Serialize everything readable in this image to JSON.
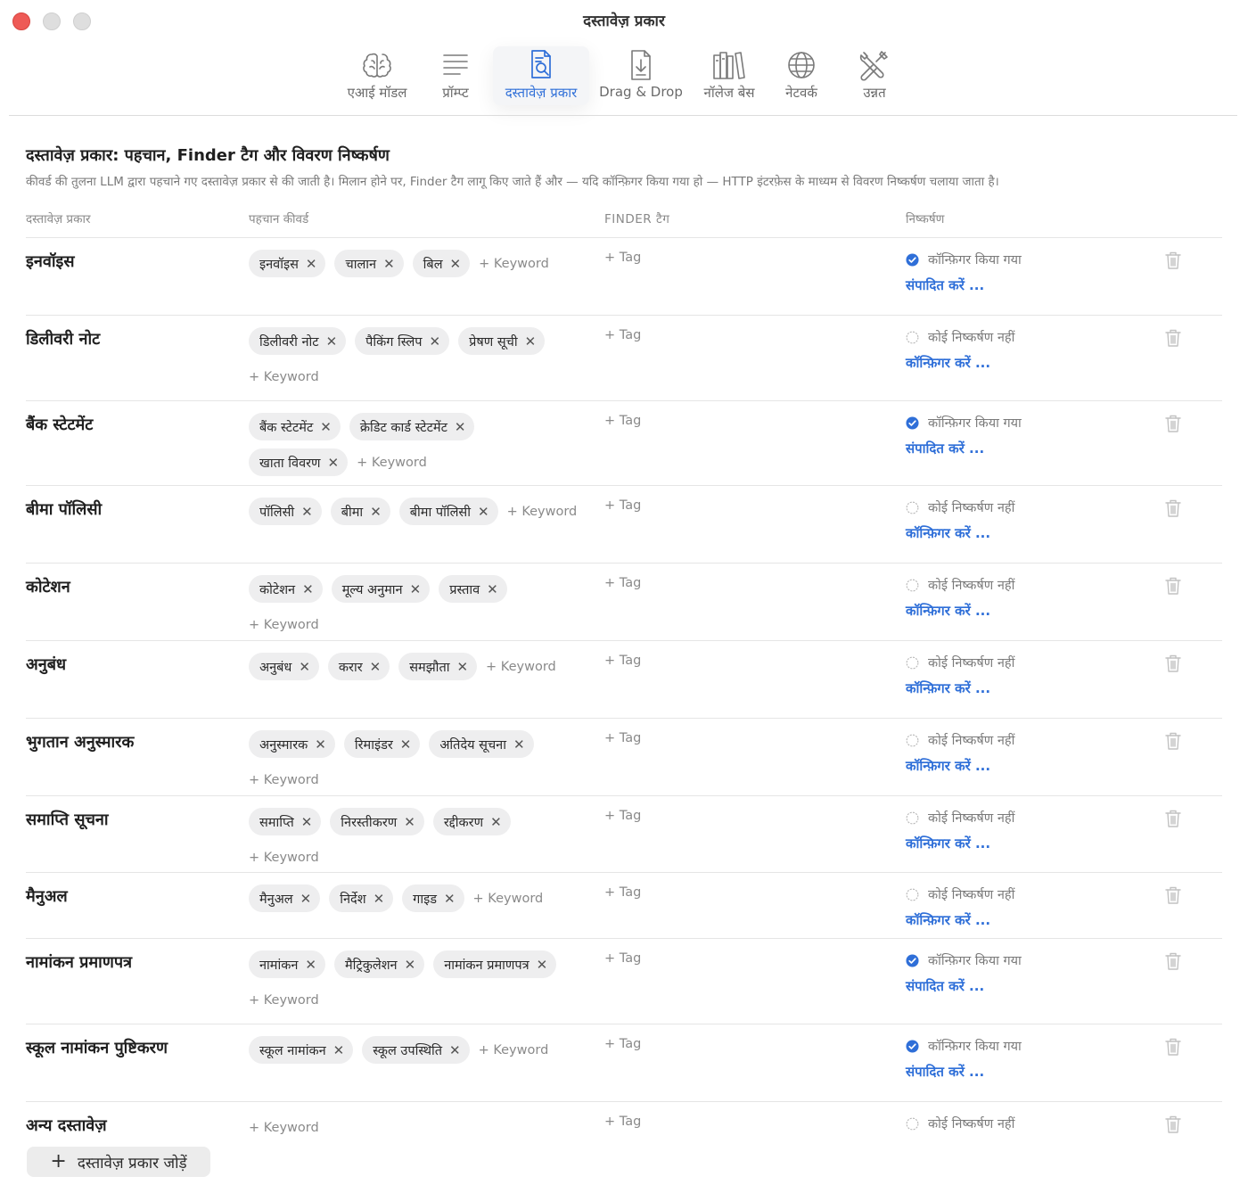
{
  "window": {
    "title": "दस्तावेज़ प्रकार"
  },
  "toolbar": [
    {
      "label": "एआई मॉडल",
      "icon": "brain-icon",
      "active": false
    },
    {
      "label": "प्रॉम्प्ट",
      "icon": "text-lines-icon",
      "active": false
    },
    {
      "label": "दस्तावेज़ प्रकार",
      "icon": "document-search-icon",
      "active": true
    },
    {
      "label": "Drag & Drop",
      "icon": "document-download-icon",
      "active": false
    },
    {
      "label": "नॉलेज बेस",
      "icon": "books-icon",
      "active": false
    },
    {
      "label": "नेटवर्क",
      "icon": "globe-icon",
      "active": false
    },
    {
      "label": "उन्नत",
      "icon": "tools-icon",
      "active": false
    }
  ],
  "section": {
    "title": "दस्तावेज़ प्रकार: पहचान, Finder टैग और विवरण निष्कर्षण",
    "description": "कीवर्ड की तुलना LLM द्वारा पहचाने गए दस्तावेज़ प्रकार से की जाती है। मिलान होने पर, Finder टैग लागू किए जाते हैं और — यदि कॉन्फ़िगर किया गया हो — HTTP इंटरफ़ेस के माध्यम से विवरण निष्कर्षण चलाया जाता है।"
  },
  "columns": {
    "type": "दस्तावेज़ प्रकार",
    "keywords": "पहचान कीवर्ड",
    "finder_tag": "FINDER टैग",
    "extraction": "निष्कर्षण"
  },
  "labels": {
    "add_keyword": "+ Keyword",
    "add_tag": "+ Tag",
    "configured": "कॉन्फ़िगर किया गया",
    "not_configured": "कोई निष्कर्षण नहीं",
    "edit": "संपादित करें ...",
    "configure": "कॉन्फ़िगर करें ...",
    "remove_glyph": "✕"
  },
  "rows": [
    {
      "name": "इनवॉइस",
      "keywords": [
        "इनवॉइस",
        "चालान",
        "बिल"
      ],
      "configured": true
    },
    {
      "name": "डिलीवरी नोट",
      "keywords": [
        "डिलीवरी नोट",
        "पैकिंग स्लिप",
        "प्रेषण सूची"
      ],
      "configured": false
    },
    {
      "name": "बैंक स्टेटमेंट",
      "keywords": [
        "बैंक स्टेटमेंट",
        "क्रेडिट कार्ड स्टेटमेंट",
        "खाता विवरण"
      ],
      "configured": true
    },
    {
      "name": "बीमा पॉलिसी",
      "keywords": [
        "पॉलिसी",
        "बीमा",
        "बीमा पॉलिसी"
      ],
      "configured": false
    },
    {
      "name": "कोटेशन",
      "keywords": [
        "कोटेशन",
        "मूल्य अनुमान",
        "प्रस्ताव"
      ],
      "configured": false
    },
    {
      "name": "अनुबंध",
      "keywords": [
        "अनुबंध",
        "करार",
        "समझौता"
      ],
      "configured": false
    },
    {
      "name": "भुगतान अनुस्मारक",
      "keywords": [
        "अनुस्मारक",
        "रिमाइंडर",
        "अतिदेय सूचना"
      ],
      "configured": false
    },
    {
      "name": "समाप्ति सूचना",
      "keywords": [
        "समाप्ति",
        "निरस्तीकरण",
        "रद्दीकरण"
      ],
      "configured": false
    },
    {
      "name": "मैनुअल",
      "keywords": [
        "मैनुअल",
        "निर्देश",
        "गाइड"
      ],
      "configured": false
    },
    {
      "name": "नामांकन प्रमाणपत्र",
      "keywords": [
        "नामांकन",
        "मैट्रिकुलेशन",
        "नामांकन प्रमाणपत्र"
      ],
      "configured": true
    },
    {
      "name": "स्कूल नामांकन पुष्टिकरण",
      "keywords": [
        "स्कूल नामांकन",
        "स्कूल उपस्थिति"
      ],
      "configured": true
    },
    {
      "name": "अन्य दस्तावेज़",
      "keywords": [],
      "configured": false,
      "no_link": true
    }
  ],
  "footer": {
    "add_type_label": "दस्तावेज़ प्रकार जोड़ें"
  },
  "colors": {
    "accent": "#2f6fd8",
    "close": "#ee5a56",
    "chip": "#eeeeef"
  }
}
